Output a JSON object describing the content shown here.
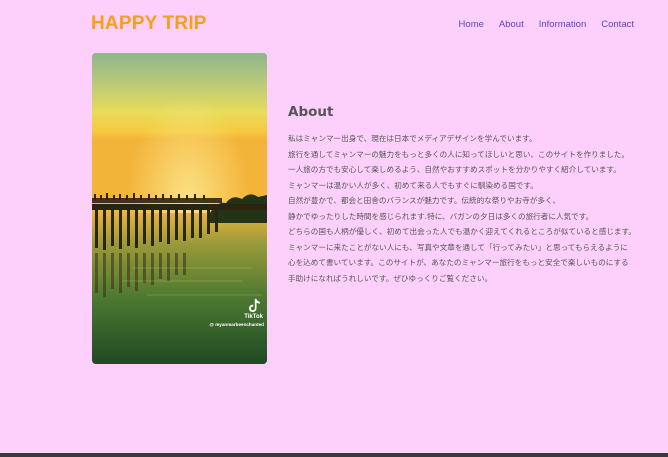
{
  "site": {
    "logo": "HAPPY TRIP"
  },
  "nav": {
    "items": [
      "Home",
      "About",
      "Information",
      "Contact"
    ]
  },
  "photo": {
    "watermark_brand": "TikTok",
    "watermark_handle": "@ myanmarbeenchanted"
  },
  "about": {
    "heading": "About",
    "paragraphs": [
      "私はミャンマー出身で、現在は日本でメディアデザインを学んでいます。",
      "旅行を通してミャンマーの魅力をもっと多くの人に知ってほしいと思い、このサイトを作りました。",
      "一人旅の方でも安心して楽しめるよう、自然やおすすめスポットを分かりやすく紹介しています。",
      "ミャンマーは温かい人が多く、初めて来る人でもすぐに馴染める国です。",
      "自然が豊かで、都会と田舎のバランスが魅力です。伝統的な祭りやお寺が多く、",
      "静かでゆったりした時間を感じられます.特に、バガンの夕日は多くの旅行者に人気です。",
      "どちらの国も人柄が優しく、初めて出会った人でも温かく迎えてくれるところが似ていると感じます。",
      "ミャンマーに来たことがない人にも、写真や文章を通して「行ってみたい」と思ってもらえるように",
      "心を込めて書いています。このサイトが、あなたのミャンマー旅行をもっと安全で楽しいものにする",
      "手助けになればうれしいです。ぜひゆっくりご覧ください。"
    ]
  },
  "colors": {
    "background": "#fdd0fb",
    "logo": "#f5a019",
    "nav_link": "#5a43d2",
    "body_text": "#555555"
  }
}
